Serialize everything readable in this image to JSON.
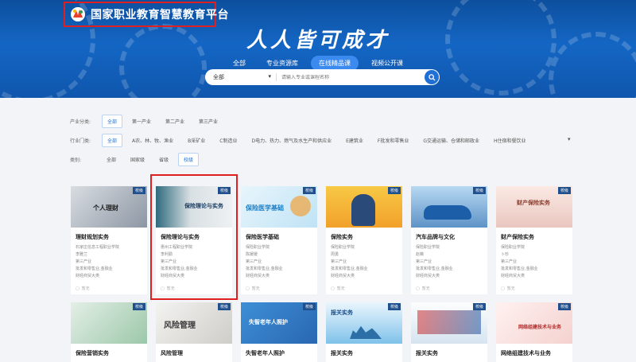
{
  "header": {
    "site_title": "国家职业教育智慧教育平台",
    "slogan": "人人皆可成才",
    "tabs": [
      {
        "label": "全部",
        "active": false
      },
      {
        "label": "专业资源库",
        "active": false
      },
      {
        "label": "在线精品课",
        "active": true
      },
      {
        "label": "视频公开课",
        "active": false
      }
    ],
    "search": {
      "scope": "全部",
      "placeholder": "请输入专业或课程名称"
    }
  },
  "filters": {
    "industry_category": {
      "label": "产业分类:",
      "options": [
        "全部",
        "第一产业",
        "第二产业",
        "第三产业"
      ],
      "active": 0
    },
    "industry_sector": {
      "label": "行业门类:",
      "options": [
        "全部",
        "A农、林、牧、渔业",
        "B采矿业",
        "C制造业",
        "D电力、热力、燃气及水生产和供应业",
        "E建筑业",
        "F批发和零售业",
        "G交通运输、仓储和邮政业",
        "H住宿和餐饮业"
      ],
      "active": 0
    },
    "level": {
      "label": "类别:",
      "options": [
        "全部",
        "国家级",
        "省级",
        "校级"
      ],
      "active": 3
    }
  },
  "cards_row1": [
    {
      "title": "理财规划实务",
      "school": "石家庄信息工程职业学院",
      "teacher": "李雅兰",
      "industry": "第三产业",
      "sector": "批发和零售业,金融业",
      "category": "财经商贸大类",
      "tag": "校级",
      "footer": "暂无",
      "thumb_text": "个人理财"
    },
    {
      "title": "保险理论与实务",
      "school": "惠州工程职业学院",
      "teacher": "李利勤",
      "industry": "第三产业",
      "sector": "批发和零售业,金融业",
      "category": "财经商贸大类",
      "tag": "校级",
      "footer": "暂无",
      "thumb_text": "保险理论与实务"
    },
    {
      "title": "保险医学基础",
      "school": "保险职业学院",
      "teacher": "陈媛媛",
      "industry": "第三产业",
      "sector": "批发和零售业,金融业",
      "category": "财经商贸大类",
      "tag": "校级",
      "footer": "暂无",
      "thumb_text": "保险医学基础"
    },
    {
      "title": "保险实务",
      "school": "保险职业学院",
      "teacher": "周勇",
      "industry": "第三产业",
      "sector": "批发和零售业,金融业",
      "category": "财经商贸大类",
      "tag": "校级",
      "footer": "暂无",
      "thumb_text": ""
    },
    {
      "title": "汽车品牌与文化",
      "school": "保险职业学院",
      "teacher": "赵薇",
      "industry": "第三产业",
      "sector": "批发和零售业,金融业",
      "category": "财经商贸大类",
      "tag": "校级",
      "footer": "暂无",
      "thumb_text": ""
    },
    {
      "title": "财产保险实务",
      "school": "保险职业学院",
      "teacher": "卜珍",
      "industry": "第三产业",
      "sector": "批发和零售业,金融业",
      "category": "财经商贸大类",
      "tag": "校级",
      "footer": "暂无",
      "thumb_text": "财产保险实务"
    }
  ],
  "cards_row2": [
    {
      "title": "保险营销实务",
      "tag": "校级",
      "thumb_text": ""
    },
    {
      "title": "风险管理",
      "tag": "校级",
      "thumb_text": "风险管理"
    },
    {
      "title": "失智老年人照护",
      "tag": "校级",
      "thumb_text": "失智老年人照护"
    },
    {
      "title": "报关实务",
      "tag": "校级",
      "thumb_text": "报关实务"
    },
    {
      "title": "报关实务",
      "tag": "校级",
      "thumb_text": ""
    },
    {
      "title": "网络组建技术与业务",
      "tag": "校级",
      "thumb_text": "网络组建技术与业务"
    }
  ],
  "colors": {
    "brand_blue": "#1466c4",
    "highlight_red": "#e02020",
    "tag_bg": "#1f4f8c"
  }
}
